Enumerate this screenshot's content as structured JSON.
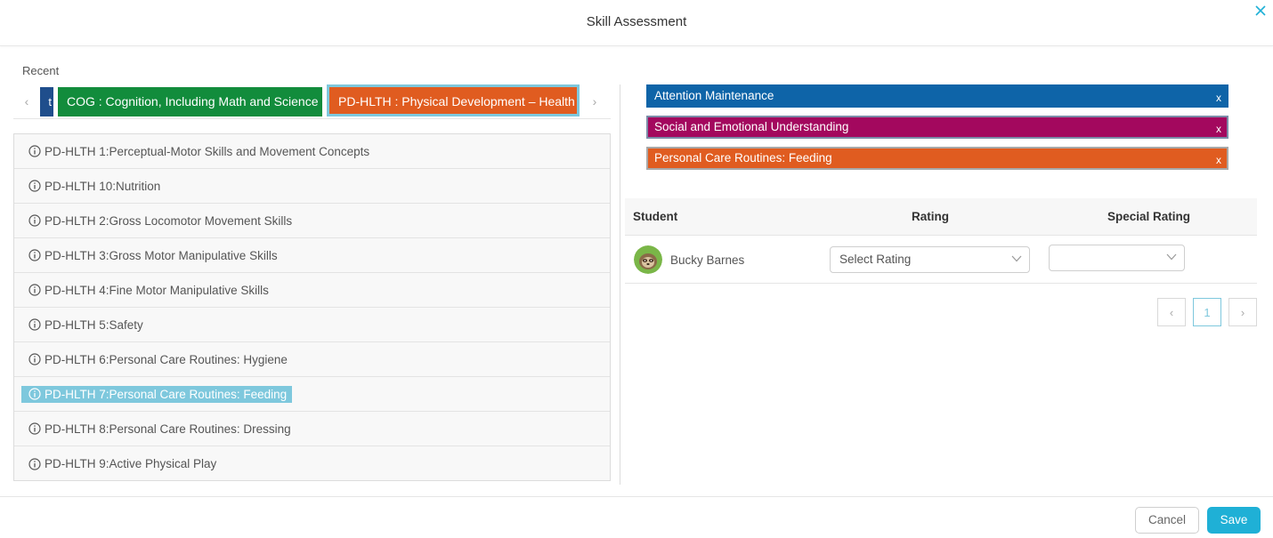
{
  "header": {
    "title": "Skill Assessment"
  },
  "recent_label": "Recent",
  "tabs": [
    {
      "label": "t",
      "color": "#1f4e8c",
      "partial": true
    },
    {
      "label": "COG : Cognition, Including Math and Science",
      "color": "#128c3c"
    },
    {
      "label": "PD-HLTH : Physical Development – Health",
      "color": "#e05c20",
      "active": true
    }
  ],
  "skills": [
    {
      "label": "PD-HLTH 1:Perceptual-Motor Skills and Movement Concepts"
    },
    {
      "label": "PD-HLTH 10:Nutrition"
    },
    {
      "label": "PD-HLTH 2:Gross Locomotor Movement Skills"
    },
    {
      "label": "PD-HLTH 3:Gross Motor Manipulative Skills"
    },
    {
      "label": "PD-HLTH 4:Fine Motor Manipulative Skills"
    },
    {
      "label": "PD-HLTH 5:Safety"
    },
    {
      "label": "PD-HLTH 6:Personal Care Routines: Hygiene"
    },
    {
      "label": "PD-HLTH 7:Personal Care Routines: Feeding",
      "selected": true
    },
    {
      "label": "PD-HLTH 8:Personal Care Routines: Dressing"
    },
    {
      "label": "PD-HLTH 9:Active Physical Play"
    }
  ],
  "selected_chips": [
    {
      "label": "Attention Maintenance",
      "color": "#0e64a8",
      "remove": "x"
    },
    {
      "label": "Social and Emotional Understanding",
      "color": "#a3085e",
      "remove": "x"
    },
    {
      "label": "Personal Care Routines: Feeding",
      "color": "#e05c20",
      "remove": "x"
    }
  ],
  "table": {
    "headers": {
      "student": "Student",
      "rating": "Rating",
      "special_rating": "Special Rating"
    },
    "rows": [
      {
        "student": "Bucky Barnes",
        "rating_placeholder": "Select Rating",
        "special_rating": ""
      }
    ]
  },
  "pagination": {
    "prev": "‹",
    "current": "1",
    "next": "›"
  },
  "footer": {
    "cancel": "Cancel",
    "save": "Save"
  },
  "colors": {
    "accent": "#1fb0d6",
    "selected_highlight": "#7ec8dd"
  }
}
